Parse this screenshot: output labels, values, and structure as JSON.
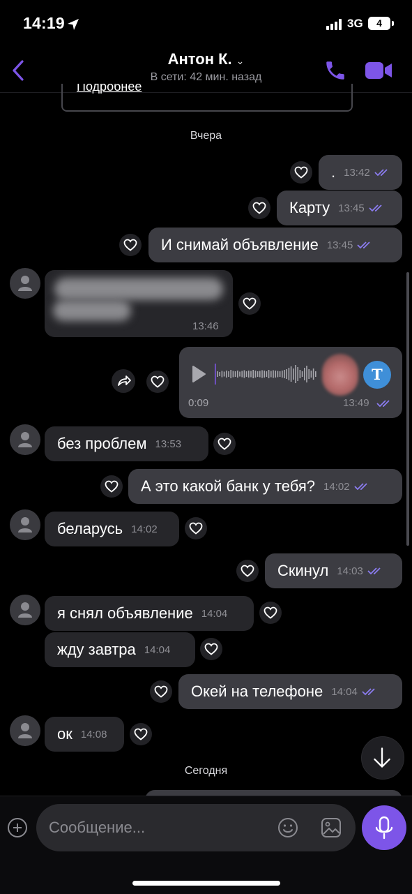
{
  "status_bar": {
    "time": "14:19",
    "network": "3G",
    "battery": "4"
  },
  "header": {
    "contact_name": "Антон К.",
    "chevron": "⌄",
    "status": "В сети: 42 мин. назад"
  },
  "top_card": {
    "link_text": "Подробнее"
  },
  "date_separators": {
    "yesterday": "Вчера",
    "today": "Сегодня"
  },
  "messages": [
    {
      "dir": "out",
      "text": ".",
      "time": "13:42"
    },
    {
      "dir": "out",
      "text": "Карту",
      "time": "13:45"
    },
    {
      "dir": "out",
      "text": "И снимай объявление",
      "time": "13:45"
    },
    {
      "dir": "in",
      "text": "",
      "time": "13:46",
      "blurred": true
    },
    {
      "dir": "out",
      "type": "voice",
      "duration": "0:09",
      "time": "13:49"
    },
    {
      "dir": "in",
      "text": "без проблем",
      "time": "13:53"
    },
    {
      "dir": "out",
      "text": "А это какой банк у тебя?",
      "time": "14:02"
    },
    {
      "dir": "in",
      "text": "беларусь",
      "time": "14:02"
    },
    {
      "dir": "out",
      "text": "Скинул",
      "time": "14:03"
    },
    {
      "dir": "in",
      "text": "я снял объявление",
      "time": "14:04"
    },
    {
      "dir": "in",
      "text": "жду завтра",
      "time": "14:04"
    },
    {
      "dir": "out",
      "text": "Окей на телефоне",
      "time": "14:04"
    },
    {
      "dir": "in",
      "text": "ок",
      "time": "14:08"
    }
  ],
  "voice": {
    "transcribe_label": "T"
  },
  "composer": {
    "placeholder": "Сообщение..."
  },
  "colors": {
    "accent": "#7d55e8",
    "tick": "#8b7cf0",
    "outgoing_bubble": "#3c3c42",
    "incoming_bubble": "#26262a"
  },
  "icons": [
    "location-arrow-icon",
    "signal-icon",
    "battery-icon",
    "back-chevron-icon",
    "phone-icon",
    "video-camera-icon",
    "heart-icon",
    "share-icon",
    "play-icon",
    "waveform-icon",
    "double-check-icon",
    "avatar-icon",
    "arrow-down-icon",
    "plus-icon",
    "emoji-icon",
    "sticker-icon",
    "microphone-icon"
  ]
}
